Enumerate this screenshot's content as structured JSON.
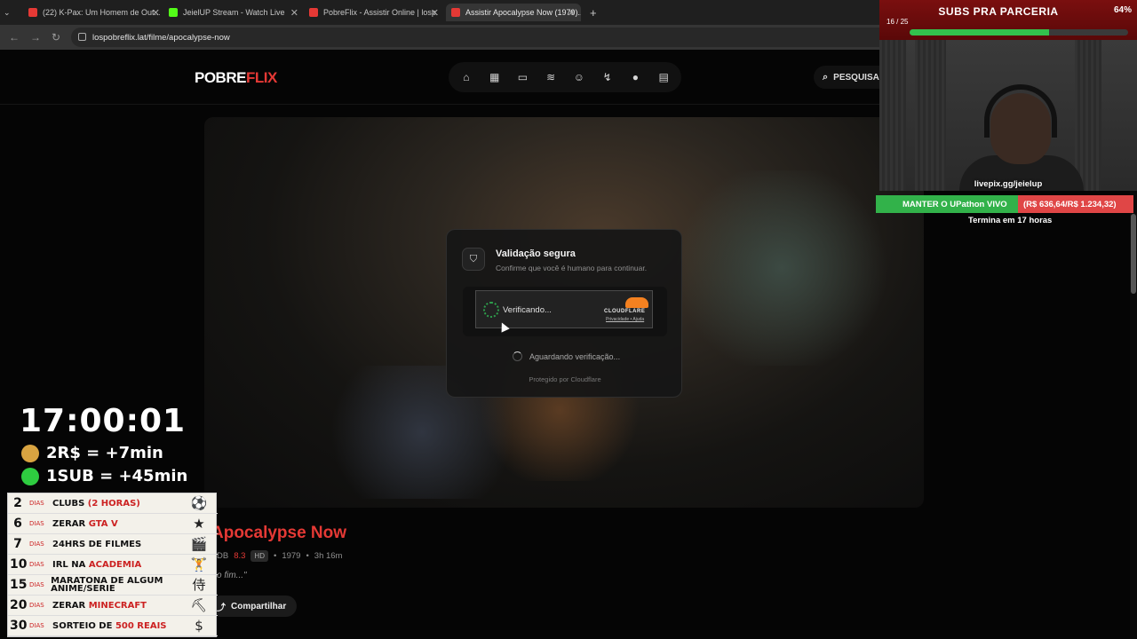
{
  "browser": {
    "tabs": [
      {
        "title": "(22) K-Pax: Um Homem de Out...",
        "favicon_color": "#e53935"
      },
      {
        "title": "JeielUP Stream - Watch Live",
        "favicon_color": "#53fc18"
      },
      {
        "title": "PobreFlix - Assistir Online | losp...",
        "favicon_color": "#e53935"
      },
      {
        "title": "Assistir Apocalypse Now (1979)...",
        "favicon_color": "#e53935"
      }
    ],
    "active_tab_index": 3,
    "url": "lospobreflix.lat/filme/apocalypse-now"
  },
  "site": {
    "logo_part1": "POBRE",
    "logo_part2": "FLIX",
    "nav_icons": [
      "home-icon",
      "film-icon",
      "tv-icon",
      "anime-icon",
      "mask-icon",
      "reel-icon",
      "soccer-icon",
      "calendar-icon"
    ],
    "search_label": "PESQUISA",
    "verification": {
      "title": "Validação segura",
      "subtitle": "Confirme que você é humano para continuar.",
      "widget_status": "Verificando...",
      "widget_brand": "CLOUDFLARE",
      "widget_links": "Privacidade • Ajuda",
      "waiting_text": "Aguardando verificação...",
      "protected_text": "Protegido por Cloudflare"
    },
    "movie": {
      "title": "Apocalypse Now",
      "imdb_label": "DB",
      "rating": "8.3",
      "quality_badge": "HD",
      "year": "1979",
      "duration": "3h 16m",
      "tagline": "o fim...\"",
      "share_label": "Compartilhar"
    }
  },
  "stream": {
    "goal": {
      "title": "SUBS PRA PARCERIA",
      "percent_label": "64%",
      "count_label": "16 / 25",
      "progress": 0.64
    },
    "webcam_label": "livepix.gg/jeielup",
    "marathon_left": "MANTER O UPathon VIVO",
    "marathon_right": "(R$ 636,64/R$ 1.234,32)",
    "ends_label": "Termina em 17 horas",
    "timer": "17:00:01",
    "rules": [
      {
        "text": "2R$ = +7min",
        "icon_color": "#d9a441"
      },
      {
        "text": "1SUB = +45min",
        "icon_color": "#2ecc40"
      }
    ],
    "goals_list": [
      {
        "num": "2",
        "dias": "DIAS",
        "text": "CLUBS",
        "extra": "(2 HORAS)",
        "icon": "⚽"
      },
      {
        "num": "6",
        "dias": "DIAS",
        "text": "ZERAR",
        "extra": "GTA V",
        "icon": "★"
      },
      {
        "num": "7",
        "dias": "DIAS",
        "text": "24HRS DE FILMES",
        "extra": "",
        "icon": "🎬"
      },
      {
        "num": "10",
        "dias": "DIAS",
        "text": "IRL NA",
        "extra": "ACADEMIA",
        "icon": "🏋"
      },
      {
        "num": "15",
        "dias": "DIAS",
        "text": "MARATONA DE ALGUM ANIME/SERIE",
        "extra": "",
        "icon": "侍"
      },
      {
        "num": "20",
        "dias": "DIAS",
        "text": "ZERAR",
        "extra": "MINECRAFT",
        "icon": "⛏"
      },
      {
        "num": "30",
        "dias": "DIAS",
        "text": "SORTEIO DE",
        "extra": "500 REAIS",
        "icon": "$"
      }
    ]
  }
}
